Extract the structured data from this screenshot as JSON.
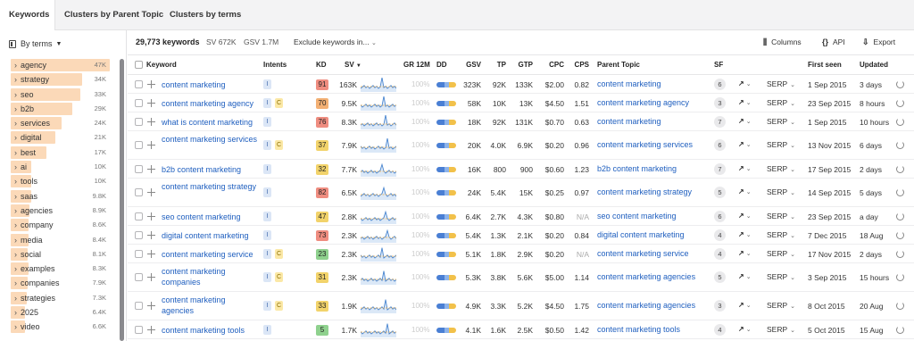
{
  "tabs": [
    {
      "label": "Keywords",
      "active": true
    },
    {
      "label": "Clusters by Parent Topic",
      "active": false
    },
    {
      "label": "Clusters by terms",
      "active": false
    }
  ],
  "sidebar": {
    "header": "By terms",
    "items": [
      {
        "term": "agency",
        "count": "47K",
        "share": 1.0
      },
      {
        "term": "strategy",
        "count": "34K",
        "share": 0.72
      },
      {
        "term": "seo",
        "count": "33K",
        "share": 0.7
      },
      {
        "term": "b2b",
        "count": "29K",
        "share": 0.62
      },
      {
        "term": "services",
        "count": "24K",
        "share": 0.51
      },
      {
        "term": "digital",
        "count": "21K",
        "share": 0.45
      },
      {
        "term": "best",
        "count": "17K",
        "share": 0.36
      },
      {
        "term": "ai",
        "count": "10K",
        "share": 0.21
      },
      {
        "term": "tools",
        "count": "10K",
        "share": 0.21
      },
      {
        "term": "saas",
        "count": "9.8K",
        "share": 0.21
      },
      {
        "term": "agencies",
        "count": "8.9K",
        "share": 0.19
      },
      {
        "term": "company",
        "count": "8.6K",
        "share": 0.18
      },
      {
        "term": "media",
        "count": "8.4K",
        "share": 0.18
      },
      {
        "term": "social",
        "count": "8.1K",
        "share": 0.17
      },
      {
        "term": "examples",
        "count": "8.3K",
        "share": 0.18
      },
      {
        "term": "companies",
        "count": "7.9K",
        "share": 0.17
      },
      {
        "term": "strategies",
        "count": "7.3K",
        "share": 0.16
      },
      {
        "term": "2025",
        "count": "6.4K",
        "share": 0.14
      },
      {
        "term": "video",
        "count": "6.6K",
        "share": 0.14
      }
    ]
  },
  "toolbar": {
    "total": "29,773 keywords",
    "sv": "SV 672K",
    "gsv": "GSV 1.7M",
    "exclude": "Exclude keywords in...",
    "columns": "Columns",
    "api": "API",
    "export": "Export"
  },
  "columns": {
    "keyword": "Keyword",
    "intents": "Intents",
    "kd": "KD",
    "sv": "SV",
    "gr12m": "GR 12M",
    "dd": "DD",
    "gsv": "GSV",
    "tp": "TP",
    "gtp": "GTP",
    "cpc": "CPC",
    "cps": "CPS",
    "parent_topic": "Parent Topic",
    "sf": "SF",
    "first_seen": "First seen",
    "updated": "Updated"
  },
  "colors": {
    "kd_red": "#ef8d80",
    "kd_orange": "#f3b074",
    "kd_yellow": "#f2d36b",
    "kd_green": "#8fd18e",
    "link": "#1f5fbf",
    "sidebar_bar": "#fbd9b8"
  },
  "rows": [
    {
      "keyword": "content marketing",
      "intents": [
        "I"
      ],
      "kd": "91",
      "kd_level": "red",
      "sv": "163K",
      "gr12m": "100%",
      "gsv": "323K",
      "tp": "92K",
      "gtp": "133K",
      "cpc": "$2.00",
      "cps": "0.82",
      "parent_topic": "content marketing",
      "sf": "6",
      "serp": "SERP",
      "first_seen": "1 Sep 2015",
      "updated": "3 days"
    },
    {
      "keyword": "content marketing agency",
      "intents": [
        "I",
        "C"
      ],
      "kd": "70",
      "kd_level": "orange",
      "sv": "9.5K",
      "gr12m": "100%",
      "gsv": "58K",
      "tp": "10K",
      "gtp": "13K",
      "cpc": "$4.50",
      "cps": "1.51",
      "parent_topic": "content marketing agency",
      "sf": "3",
      "serp": "SERP",
      "first_seen": "23 Sep 2015",
      "updated": "8 hours"
    },
    {
      "keyword": "what is content marketing",
      "intents": [
        "I"
      ],
      "kd": "76",
      "kd_level": "red",
      "sv": "8.3K",
      "gr12m": "100%",
      "gsv": "18K",
      "tp": "92K",
      "gtp": "131K",
      "cpc": "$0.70",
      "cps": "0.63",
      "parent_topic": "content marketing",
      "sf": "7",
      "serp": "SERP",
      "first_seen": "1 Sep 2015",
      "updated": "10 hours"
    },
    {
      "keyword": "content marketing services",
      "intents": [
        "I",
        "C"
      ],
      "kd": "37",
      "kd_level": "yellow",
      "sv": "7.9K",
      "gr12m": "100%",
      "gsv": "20K",
      "tp": "4.0K",
      "gtp": "6.9K",
      "cpc": "$0.20",
      "cps": "0.96",
      "parent_topic": "content marketing services",
      "sf": "6",
      "serp": "SERP",
      "first_seen": "13 Nov 2015",
      "updated": "6 days"
    },
    {
      "keyword": "b2b content marketing",
      "intents": [
        "I"
      ],
      "kd": "32",
      "kd_level": "yellow",
      "sv": "7.7K",
      "gr12m": "100%",
      "gsv": "16K",
      "tp": "800",
      "gtp": "900",
      "cpc": "$0.60",
      "cps": "1.23",
      "parent_topic": "b2b content marketing",
      "sf": "7",
      "serp": "SERP",
      "first_seen": "17 Sep 2015",
      "updated": "2 days"
    },
    {
      "keyword": "content marketing strategy",
      "intents": [
        "I"
      ],
      "kd": "82",
      "kd_level": "red",
      "sv": "6.5K",
      "gr12m": "100%",
      "gsv": "24K",
      "tp": "5.4K",
      "gtp": "15K",
      "cpc": "$0.25",
      "cps": "0.97",
      "parent_topic": "content marketing strategy",
      "sf": "5",
      "serp": "SERP",
      "first_seen": "14 Sep 2015",
      "updated": "5 days"
    },
    {
      "keyword": "seo content marketing",
      "intents": [
        "I"
      ],
      "kd": "47",
      "kd_level": "yellow",
      "sv": "2.8K",
      "gr12m": "100%",
      "gsv": "6.4K",
      "tp": "2.7K",
      "gtp": "4.3K",
      "cpc": "$0.80",
      "cps": "N/A",
      "parent_topic": "seo content marketing",
      "sf": "6",
      "serp": "SERP",
      "first_seen": "23 Sep 2015",
      "updated": "a day"
    },
    {
      "keyword": "digital content marketing",
      "intents": [
        "I"
      ],
      "kd": "73",
      "kd_level": "red",
      "sv": "2.3K",
      "gr12m": "100%",
      "gsv": "5.4K",
      "tp": "1.3K",
      "gtp": "2.1K",
      "cpc": "$0.20",
      "cps": "0.84",
      "parent_topic": "digital content marketing",
      "sf": "4",
      "serp": "SERP",
      "first_seen": "7 Dec 2015",
      "updated": "18 Aug"
    },
    {
      "keyword": "content marketing service",
      "intents": [
        "I",
        "C"
      ],
      "kd": "23",
      "kd_level": "green",
      "sv": "2.3K",
      "gr12m": "100%",
      "gsv": "5.1K",
      "tp": "1.8K",
      "gtp": "2.9K",
      "cpc": "$0.20",
      "cps": "N/A",
      "parent_topic": "content marketing service",
      "sf": "4",
      "serp": "SERP",
      "first_seen": "17 Nov 2015",
      "updated": "2 days"
    },
    {
      "keyword": "content marketing companies",
      "intents": [
        "I",
        "C"
      ],
      "kd": "31",
      "kd_level": "yellow",
      "sv": "2.3K",
      "gr12m": "100%",
      "gsv": "5.3K",
      "tp": "3.8K",
      "gtp": "5.6K",
      "cpc": "$5.00",
      "cps": "1.14",
      "parent_topic": "content marketing agencies",
      "sf": "5",
      "serp": "SERP",
      "first_seen": "3 Sep 2015",
      "updated": "15 hours"
    },
    {
      "keyword": "content marketing agencies",
      "intents": [
        "I",
        "C"
      ],
      "kd": "33",
      "kd_level": "yellow",
      "sv": "1.9K",
      "gr12m": "100%",
      "gsv": "4.9K",
      "tp": "3.3K",
      "gtp": "5.2K",
      "cpc": "$4.50",
      "cps": "1.75",
      "parent_topic": "content marketing agencies",
      "sf": "3",
      "serp": "SERP",
      "first_seen": "8 Oct 2015",
      "updated": "20 Aug"
    },
    {
      "keyword": "content marketing tools",
      "intents": [
        "I"
      ],
      "kd": "5",
      "kd_level": "green",
      "sv": "1.7K",
      "gr12m": "100%",
      "gsv": "4.1K",
      "tp": "1.6K",
      "gtp": "2.5K",
      "cpc": "$0.50",
      "cps": "1.42",
      "parent_topic": "content marketing tools",
      "sf": "4",
      "serp": "SERP",
      "first_seen": "5 Oct 2015",
      "updated": "15 Aug"
    }
  ]
}
